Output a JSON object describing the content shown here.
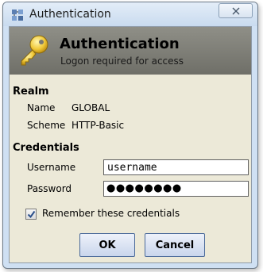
{
  "window": {
    "title": "Authentication",
    "close_symbol": "✕"
  },
  "banner": {
    "title": "Authentication",
    "subtitle": "Logon required for access",
    "icon": "key-icon"
  },
  "realm": {
    "heading": "Realm",
    "name_label": "Name",
    "name_value": "GLOBAL",
    "scheme_label": "Scheme",
    "scheme_value": "HTTP-Basic"
  },
  "credentials": {
    "heading": "Credentials",
    "username_label": "Username",
    "username_value": "username",
    "password_label": "Password",
    "password_masked": "●●●●●●●●",
    "remember_label": "Remember these credentials",
    "remember_checked": true
  },
  "buttons": {
    "ok": "OK",
    "cancel": "Cancel"
  },
  "colors": {
    "titlebar": "#c9dbef",
    "banner": "#7f7f78",
    "panel": "#ece9d8",
    "button_border": "#4c6b9a"
  }
}
